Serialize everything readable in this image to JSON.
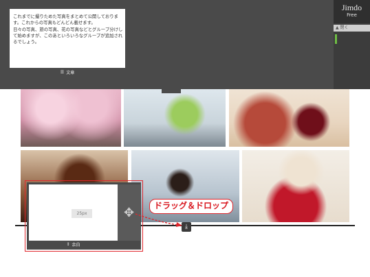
{
  "text_block": {
    "body": "これまでに撮りためた写真をまとめて公開しております。これからの写真もどんどん載せます。\n日々の写真、旅の写真、花の写真などとグループ分けして始めますが、このあといろいろなグループが追加されるでしょう。",
    "footer_label": "文章",
    "footer_icon": "text-lines-icon"
  },
  "brand": {
    "name": "Jimdo",
    "plan": "Free"
  },
  "side_panel": {
    "label": "▲ 閉く"
  },
  "spacer_widget": {
    "height_value": "25px",
    "footer_label": "余白",
    "footer_icon": "vertical-resize-icon",
    "move_icon": "move-arrows-icon"
  },
  "annotation": {
    "label": "ドラッグ＆ドロップ",
    "color": "#e0272d"
  },
  "gallery": {
    "photos": [
      "sakura-umbrella",
      "office-desk",
      "red-wine",
      "chocolate-dessert",
      "call-center",
      "kittens-stocking"
    ]
  },
  "insert_icon": "download-icon"
}
